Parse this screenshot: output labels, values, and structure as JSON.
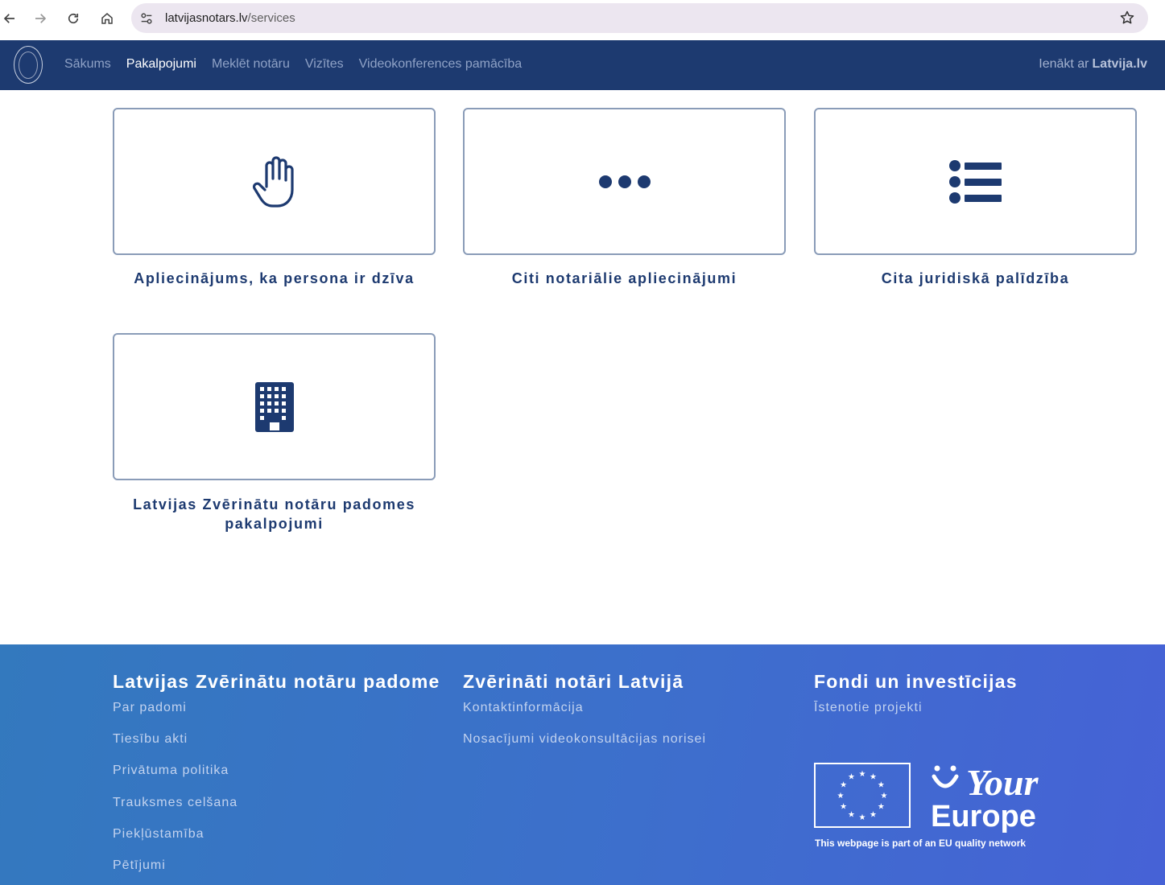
{
  "browser": {
    "url_domain": "latvijasnotars.lv",
    "url_path": "/services"
  },
  "header": {
    "nav": [
      {
        "label": "Sākums",
        "active": false
      },
      {
        "label": "Pakalpojumi",
        "active": true
      },
      {
        "label": "Meklēt notāru",
        "active": false
      },
      {
        "label": "Vizītes",
        "active": false
      },
      {
        "label": "Videokonferences pamācība",
        "active": false
      }
    ],
    "login_prefix": "Ienākt ar",
    "login_brand": "Latvija.lv"
  },
  "services": [
    {
      "label": "Apliecinājums, ka persona ir dzīva",
      "icon": "hand-icon"
    },
    {
      "label": "Citi notariālie apliecinājumi",
      "icon": "ellipsis-icon"
    },
    {
      "label": "Cita juridiskā palīdzība",
      "icon": "list-icon"
    },
    {
      "label": "Latvijas Zvērinātu notāru padomes pakalpojumi",
      "icon": "building-icon"
    }
  ],
  "footer": {
    "col1": {
      "title": "Latvijas Zvērinātu notāru padome",
      "links": [
        "Par padomi",
        "Tiesību akti",
        "Privātuma politika",
        "Trauksmes celšana",
        "Piekļūstamība",
        "Pētījumi"
      ]
    },
    "col2": {
      "title": "Zvērināti notāri Latvijā",
      "links": [
        "Kontaktinformācija",
        "Nosacījumi videokonsultācijas norisei"
      ]
    },
    "col3": {
      "title": "Fondi un investīcijas",
      "links": [
        "Īstenotie projekti"
      ]
    },
    "your_europe": {
      "your": "Your",
      "europe": "Europe",
      "tagline": "This webpage is part of an EU quality network"
    }
  },
  "colors": {
    "header_bg": "#1d3a70",
    "accent": "#1d3a70",
    "card_border": "#8a9cb8",
    "footer_gradient_start": "#3379be",
    "footer_gradient_end": "#4662d6"
  }
}
